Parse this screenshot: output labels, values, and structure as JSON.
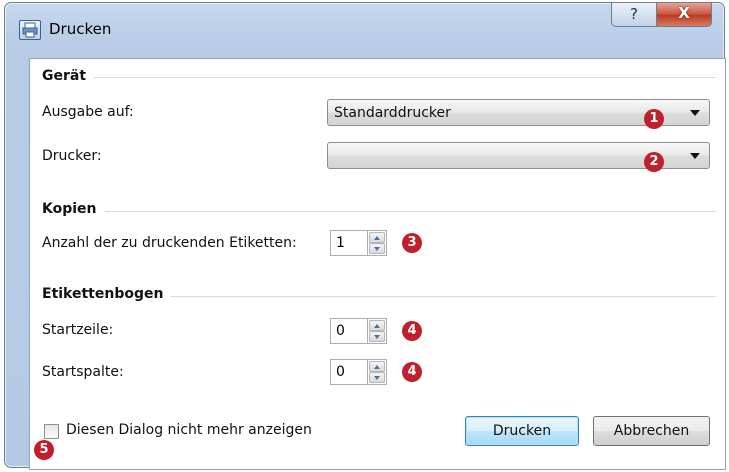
{
  "window": {
    "title": "Drucken",
    "help_glyph": "?",
    "close_glyph": "X"
  },
  "sections": {
    "geraet": "Gerät",
    "kopien": "Kopien",
    "etikettenbogen": "Etikettenbogen"
  },
  "fields": {
    "ausgabe_label": "Ausgabe auf:",
    "ausgabe_value": "Standarddrucker",
    "drucker_label": "Drucker:",
    "drucker_value": "",
    "anzahl_label": "Anzahl der zu druckenden Etiketten:",
    "anzahl_value": "1",
    "startzeile_label": "Startzeile:",
    "startzeile_value": "0",
    "startspalte_label": "Startspalte:",
    "startspalte_value": "0"
  },
  "checkbox": {
    "label": "Diesen Dialog nicht mehr anzeigen",
    "checked": false
  },
  "buttons": {
    "print": "Drucken",
    "cancel": "Abbrechen"
  },
  "markers": [
    "1",
    "2",
    "3",
    "4",
    "4",
    "5"
  ],
  "colors": {
    "marker": "#c01f2b",
    "frame": "#b7cbe6"
  }
}
